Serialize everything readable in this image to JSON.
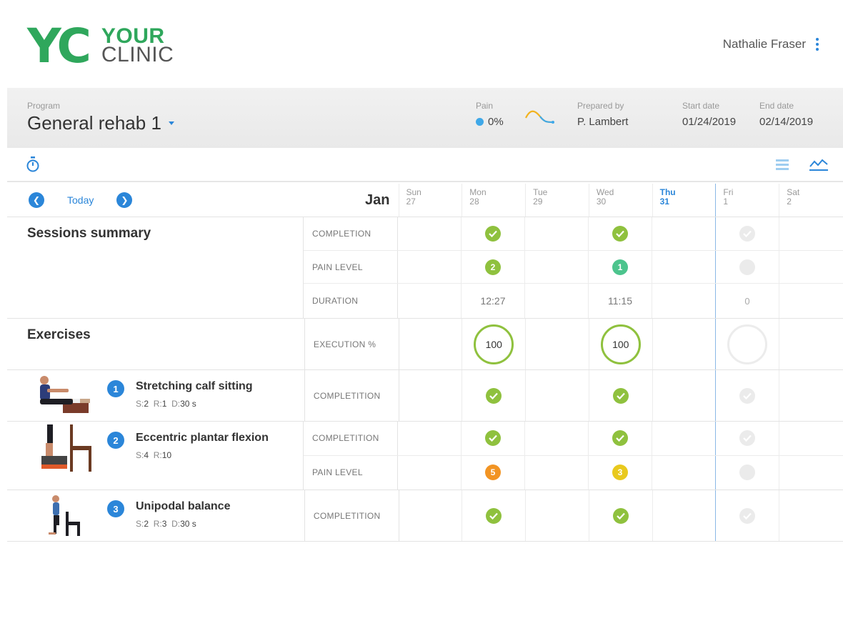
{
  "header": {
    "logo_mark": "YC",
    "logo_line1": "YOUR",
    "logo_line2": "CLINIC",
    "user_name": "Nathalie Fraser"
  },
  "program_bar": {
    "program_label": "Program",
    "program_value": "General rehab 1",
    "pain_label": "Pain",
    "pain_value": "0%",
    "prepared_label": "Prepared by",
    "prepared_value": "P. Lambert",
    "start_label": "Start date",
    "start_value": "01/24/2019",
    "end_label": "End date",
    "end_value": "02/14/2019"
  },
  "calendar": {
    "today_label": "Today",
    "month": "Jan",
    "days": [
      {
        "name": "Sun",
        "num": "27"
      },
      {
        "name": "Mon",
        "num": "28"
      },
      {
        "name": "Tue",
        "num": "29"
      },
      {
        "name": "Wed",
        "num": "30"
      },
      {
        "name": "Thu",
        "num": "31"
      },
      {
        "name": "Fri",
        "num": "1"
      },
      {
        "name": "Sat",
        "num": "2"
      }
    ]
  },
  "sessions": {
    "title": "Sessions summary",
    "completion_label": "COMPLETION",
    "pain_label": "PAIN LEVEL",
    "duration_label": "DURATION",
    "pain_mon": "2",
    "pain_wed": "1",
    "duration_mon": "12:27",
    "duration_wed": "11:15",
    "duration_fri": "0"
  },
  "exercises": {
    "title": "Exercises",
    "execution_label": "EXECUTION %",
    "exec_mon": "100",
    "exec_wed": "100",
    "completion_label": "COMPLETITION",
    "pain_label": "PAIN LEVEL",
    "items": [
      {
        "num": "1",
        "name": "Stretching calf sitting",
        "s_label": "S:",
        "s": "2",
        "r_label": "R:",
        "r": "1",
        "d_label": "D:",
        "d": "30 s"
      },
      {
        "num": "2",
        "name": "Eccentric plantar flexion",
        "s_label": "S:",
        "s": "4",
        "r_label": "R:",
        "r": "10",
        "pain_mon": "5",
        "pain_wed": "3"
      },
      {
        "num": "3",
        "name": "Unipodal balance",
        "s_label": "S:",
        "s": "2",
        "r_label": "R:",
        "r": "3",
        "d_label": "D:",
        "d": "30 s"
      }
    ]
  },
  "colors": {
    "brand_green": "#2fa75c",
    "accent_blue": "#2b86d9",
    "check_green": "#8fc13e",
    "pain_orange": "#f29423",
    "pain_yellow": "#e9c91d",
    "pain_lime": "#8fc13e",
    "pain_teal": "#4cc48d"
  },
  "icons": [
    "kebab-menu-icon",
    "caret-down-icon",
    "pain-trend-icon",
    "stopwatch-icon",
    "list-view-icon",
    "graph-view-icon",
    "prev-arrow-icon",
    "next-arrow-icon",
    "check-icon"
  ]
}
